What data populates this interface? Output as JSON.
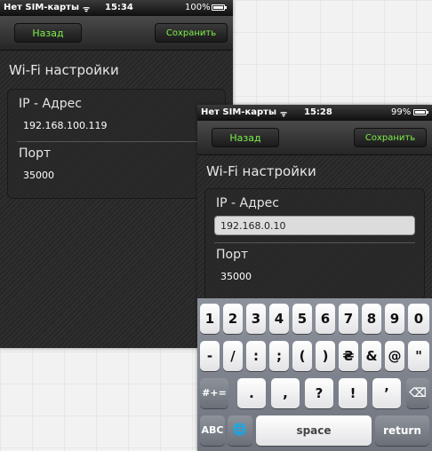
{
  "back_screen": {
    "status": {
      "carrier": "Нет SIM-карты",
      "time": "15:34",
      "battery": "100%",
      "battery_level": 1.0
    },
    "nav": {
      "back_label": "Назад",
      "save_label": "Сохранить"
    },
    "title": "Wi-Fi настройки",
    "ip": {
      "label": "IP - Адрес",
      "value": "192.168.100.119"
    },
    "port": {
      "label": "Порт",
      "value": "35000"
    }
  },
  "front_screen": {
    "status": {
      "carrier": "Нет SIM-карты",
      "time": "15:28",
      "battery": "99%",
      "battery_level": 0.99
    },
    "nav": {
      "back_label": "Назад",
      "save_label": "Сохранить"
    },
    "title": "Wi-Fi настройки",
    "ip": {
      "label": "IP - Адрес",
      "value": "192.168.0.10"
    },
    "port": {
      "label": "Порт",
      "value": "35000"
    }
  },
  "keyboard": {
    "row1": [
      "1",
      "2",
      "3",
      "4",
      "5",
      "6",
      "7",
      "8",
      "9",
      "0"
    ],
    "row2": [
      "-",
      "/",
      ":",
      ";",
      "(",
      ")",
      "₴",
      "&",
      "@",
      "\""
    ],
    "row3": {
      "shift": "#+=",
      "keys": [
        ".",
        ",",
        "?",
        "!",
        "’"
      ],
      "delete": "⌫"
    },
    "row4": {
      "abc": "ABC",
      "globe": "🌐",
      "space": "space",
      "return": "return"
    }
  }
}
